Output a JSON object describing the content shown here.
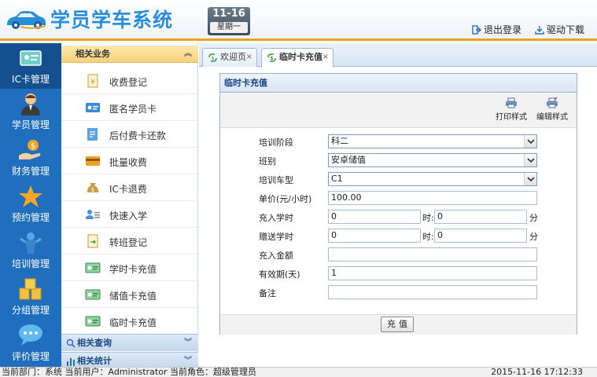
{
  "header": {
    "app_title": "学员学车系统",
    "date": "11-16",
    "weekday": "星期一",
    "logout": "退出登录",
    "driver_download": "驱动下载"
  },
  "iconbar": {
    "items": [
      {
        "label": "IC卡管理",
        "icon": "id-card-icon"
      },
      {
        "label": "学员管理",
        "icon": "student-icon"
      },
      {
        "label": "财务管理",
        "icon": "money-hand-icon"
      },
      {
        "label": "预约管理",
        "icon": "star-icon"
      },
      {
        "label": "培训管理",
        "icon": "trainer-icon"
      },
      {
        "label": "分组管理",
        "icon": "group-icon"
      },
      {
        "label": "评价管理",
        "icon": "chat-icon"
      }
    ]
  },
  "submenu": {
    "header": "相关业务",
    "items": [
      {
        "label": "收费登记"
      },
      {
        "label": "匿名学员卡"
      },
      {
        "label": "后付费卡还款"
      },
      {
        "label": "批量收费"
      },
      {
        "label": "IC卡退费"
      },
      {
        "label": "快速入学"
      },
      {
        "label": "转班登记"
      },
      {
        "label": "学时卡充值"
      },
      {
        "label": "储值卡充值"
      },
      {
        "label": "临时卡充值"
      }
    ],
    "section_query": "相关查询",
    "section_stats": "相关统计"
  },
  "tabs": [
    {
      "label": "欢迎页",
      "close": "×"
    },
    {
      "label": "临时卡充值",
      "close": "×"
    }
  ],
  "panel": {
    "title": "临时卡充值",
    "print_style": "打印样式",
    "edit_style": "编辑样式"
  },
  "form": {
    "stage_label": "培训阶段",
    "stage_value": "科二",
    "class_label": "班别",
    "class_value": "安卓储值",
    "car_label": "培训车型",
    "car_value": "C1",
    "price_label": "单价(元/小时)",
    "price_value": "100.00",
    "charge_hours_label": "充入学时",
    "charge_hours_h": "0",
    "charge_hours_m": "0",
    "gift_hours_label": "赠送学时",
    "gift_hours_h": "0",
    "gift_hours_m": "0",
    "hour_unit": "时:",
    "minute_unit": "分",
    "amount_label": "充入金额",
    "amount_value": "",
    "validity_label": "有效期(天)",
    "validity_value": "1",
    "remark_label": "备注",
    "remark_value": "",
    "submit": "充值"
  },
  "status": {
    "left": "当前部门：系统  当前用户：Administrator  当前角色：超级管理员",
    "right": "2015-11-16 17:12:33"
  }
}
